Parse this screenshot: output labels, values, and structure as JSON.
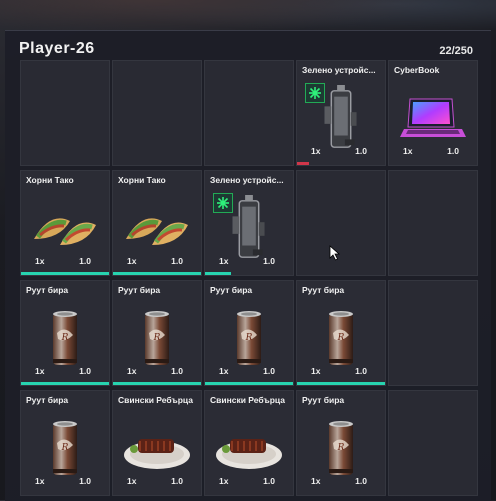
{
  "player": {
    "name": "Player-26",
    "weight": "22/250"
  },
  "slots": [
    {
      "name": "",
      "qty": "",
      "weight": ""
    },
    {
      "name": "",
      "qty": "",
      "weight": ""
    },
    {
      "name": "",
      "qty": "",
      "weight": ""
    },
    {
      "name": "Зелено устройс...",
      "qty": "1x",
      "weight": "1.0"
    },
    {
      "name": "CyberBook",
      "qty": "1x",
      "weight": "1.0"
    },
    {
      "name": "Хорни Тако",
      "qty": "1x",
      "weight": "1.0"
    },
    {
      "name": "Хорни Тако",
      "qty": "1x",
      "weight": "1.0"
    },
    {
      "name": "Зелено устройс...",
      "qty": "1x",
      "weight": "1.0"
    },
    {
      "name": "",
      "qty": "",
      "weight": ""
    },
    {
      "name": "",
      "qty": "",
      "weight": ""
    },
    {
      "name": "Руут бира",
      "qty": "1x",
      "weight": "1.0"
    },
    {
      "name": "Руут бира",
      "qty": "1x",
      "weight": "1.0"
    },
    {
      "name": "Руут бира",
      "qty": "1x",
      "weight": "1.0"
    },
    {
      "name": "Руут бира",
      "qty": "1x",
      "weight": "1.0"
    },
    {
      "name": "",
      "qty": "",
      "weight": ""
    },
    {
      "name": "Руут бира",
      "qty": "1x",
      "weight": "1.0"
    },
    {
      "name": "Свински Ребърца",
      "qty": "1x",
      "weight": "1.0"
    },
    {
      "name": "Свински Ребърца",
      "qty": "1x",
      "weight": "1.0"
    },
    {
      "name": "Руут бира",
      "qty": "1x",
      "weight": "1.0"
    },
    {
      "name": "",
      "qty": "",
      "weight": ""
    }
  ],
  "colors": {
    "accent": "#27d3b0",
    "durability_low": "#d0364a"
  }
}
